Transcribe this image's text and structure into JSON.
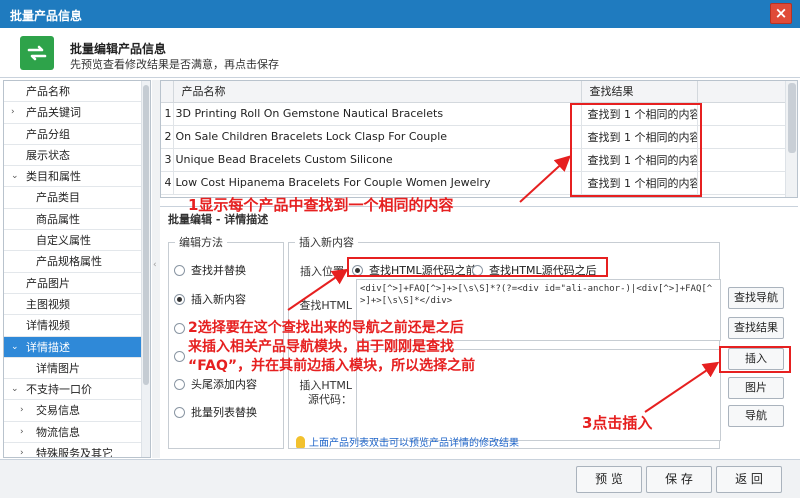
{
  "window": {
    "title": "批量产品信息",
    "close_glyph": "×"
  },
  "header": {
    "title": "批量编辑产品信息",
    "subtitle": "先预览查看修改结果是否满意，再点击保存"
  },
  "sidebar": {
    "items": [
      {
        "label": "产品名称",
        "level": 0,
        "arrow": ""
      },
      {
        "label": "产品关键词",
        "level": 0,
        "arrow": "›"
      },
      {
        "label": "产品分组",
        "level": 0,
        "arrow": ""
      },
      {
        "label": "展示状态",
        "level": 0,
        "arrow": ""
      },
      {
        "label": "类目和属性",
        "level": 0,
        "arrow": "⌄"
      },
      {
        "label": "产品类目",
        "level": 1,
        "arrow": ""
      },
      {
        "label": "商品属性",
        "level": 1,
        "arrow": ""
      },
      {
        "label": "自定义属性",
        "level": 1,
        "arrow": ""
      },
      {
        "label": "产品规格属性",
        "level": 1,
        "arrow": ""
      },
      {
        "label": "产品图片",
        "level": 0,
        "arrow": ""
      },
      {
        "label": "主图视频",
        "level": 0,
        "arrow": ""
      },
      {
        "label": "详情视频",
        "level": 0,
        "arrow": ""
      },
      {
        "label": "详情描述",
        "level": 0,
        "arrow": "⌄",
        "active": true
      },
      {
        "label": "详情图片",
        "level": 1,
        "arrow": ""
      },
      {
        "label": "不支持一口价",
        "level": 0,
        "arrow": "⌄"
      },
      {
        "label": "交易信息",
        "level": 1,
        "arrow": "›"
      },
      {
        "label": "物流信息",
        "level": 1,
        "arrow": "›"
      },
      {
        "label": "特殊服务及其它",
        "level": 1,
        "arrow": "›"
      }
    ]
  },
  "table": {
    "col_name": "产品名称",
    "col_result": "查找结果",
    "rows": [
      {
        "idx": "1",
        "name": "3D Printing Roll On Gemstone Nautical Bracelets",
        "result": "查找到 1 个相同的内容"
      },
      {
        "idx": "2",
        "name": "On Sale Children Bracelets Lock Clasp For Couple",
        "result": "查找到 1 个相同的内容"
      },
      {
        "idx": "3",
        "name": "Unique Bead Bracelets Custom Silicone",
        "result": "查找到 1 个相同的内容"
      },
      {
        "idx": "4",
        "name": "Low Cost Hipanema Bracelets For Couple Women Jewelry",
        "result": "查找到 1 个相同的内容"
      }
    ]
  },
  "edit": {
    "panel_title": "批量编辑 - 详情描述",
    "method_legend": "编辑方法",
    "methods": [
      {
        "label": "查找并替换",
        "checked": false
      },
      {
        "label": "插入新内容",
        "checked": true
      },
      {
        "label": "",
        "checked": false
      },
      {
        "label": "",
        "checked": false
      },
      {
        "label": "头尾添加内容",
        "checked": false
      },
      {
        "label": "批量列表替换",
        "checked": false
      }
    ],
    "insert_legend": "插入新内容",
    "position_label": "插入位置",
    "position_before": "查找HTML源代码之前",
    "position_after": "查找HTML源代码之后",
    "find_label_line1": "查找HTML",
    "find_code": "<div[^>]+FAQ[^>]+>[\\s\\S]*?(?=<div id=\"ali-anchor-)|<div[^>]+FAQ[^>]+>[\\s\\S]*</div>",
    "insert_label_line1": "插入HTML",
    "insert_label_line2": "源代码：",
    "btn_find_nav": "查找导航",
    "btn_find_result": "查找结果",
    "btn_insert": "插入",
    "btn_image": "图片",
    "btn_nav": "导航",
    "hint": "上面产品列表双击可以预览产品详情的修改结果"
  },
  "footer": {
    "preview": "预 览",
    "save": "保 存",
    "back": "返 回"
  },
  "annotations": {
    "a1": "1显示每个产品中查找到一个相同的内容",
    "a2_l1": "2选择要在这个查找出来的导航之前还是之后",
    "a2_l2": "来插入相关产品导航模块，由于刚刚是查找",
    "a2_l3": "“FAQ”，并在其前边插入模块，所以选择之前",
    "a3": "3点击插入"
  },
  "colors": {
    "title_bar": "#1f7bbf",
    "accent": "#2f89d8",
    "annotation": "#e62020",
    "logo_green": "#2ea34a"
  },
  "icons": {
    "logo": "refresh-arrows-icon",
    "close": "close-icon",
    "hint": "lightbulb-icon"
  }
}
